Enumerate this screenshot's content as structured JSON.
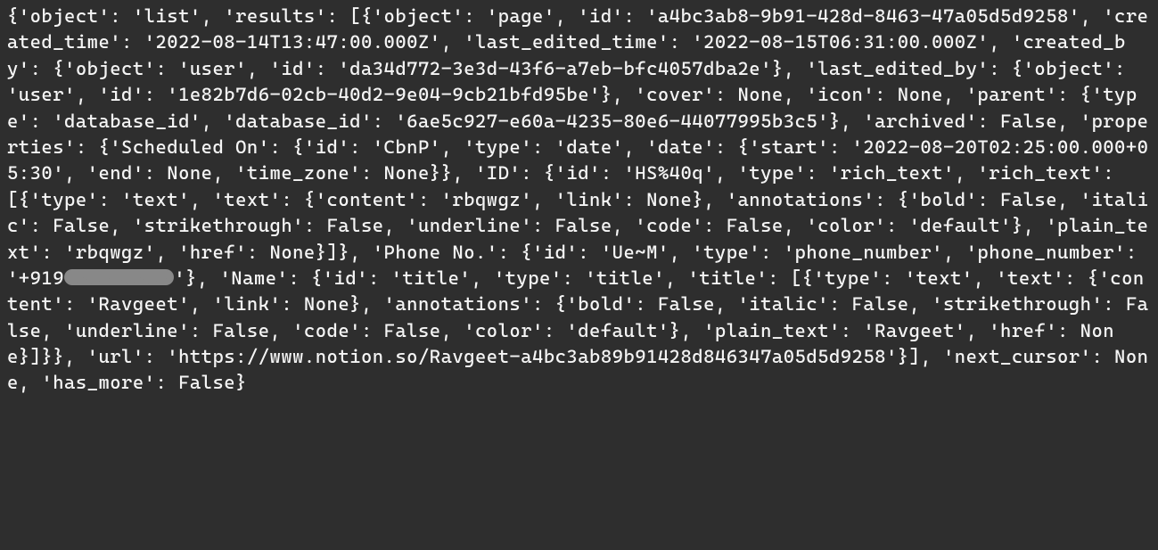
{
  "terminal": {
    "prefix": "{'object': 'list', 'results': [{'object': 'page', 'id': 'a4bc3ab8-9b91-428d-8463-47a05d5d9258', 'created_time': '2022-08-14T13:47:00.000Z', 'last_edited_time': '2022-08-15T06:31:00.000Z', 'created_by': {'object': 'user', 'id': 'da34d772-3e3d-43f6-a7eb-bfc4057dba2e'}, 'last_edited_by': {'object': 'user', 'id': '1e82b7d6-02cb-40d2-9e04-9cb21bfd95be'}, 'cover': None, 'icon': None, 'parent': {'type': 'database_id', 'database_id': '6ae5c927-e60a-4235-80e6-44077995b3c5'}, 'archived': False, 'properties': {'Scheduled On': {'id': 'CbnP', 'type': 'date', 'date': {'start': '2022-08-20T02:25:00.000+05:30', 'end': None, 'time_zone': None}}, 'ID': {'id': 'HS%40q', 'type': 'rich_text', 'rich_text': [{'type': 'text', 'text': {'content': 'rbqwgz', 'link': None}, 'annotations': {'bold': False, 'italic': False, 'strikethrough': False, 'underline': False, 'code': False, 'color': 'default'}, 'plain_text': 'rbqwgz', 'href': None}]}, 'Phone No.': {'id': 'Ue~M', 'type': 'phone_number', 'phone_number': '+919",
    "redacted_placeholder": "XXXXXXXXX",
    "suffix": "'}, 'Name': {'id': 'title', 'type': 'title', 'title': [{'type': 'text', 'text': {'content': 'Ravgeet', 'link': None}, 'annotations': {'bold': False, 'italic': False, 'strikethrough': False, 'underline': False, 'code': False, 'color': 'default'}, 'plain_text': 'Ravgeet', 'href': None}]}}, 'url': 'https://www.notion.so/Ravgeet-a4bc3ab89b91428d846347a05d5d9258'}], 'next_cursor': None, 'has_more': False}"
  }
}
